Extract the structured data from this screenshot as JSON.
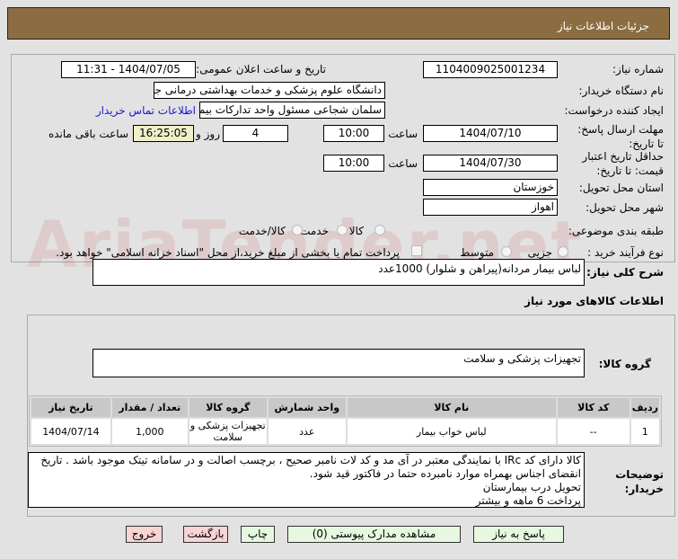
{
  "header": {
    "title": "جزئیات اطلاعات نیاز"
  },
  "form": {
    "need_number_label": "شماره نیاز:",
    "need_number": "1104009025001234",
    "announce_label": "تاریخ و ساعت اعلان عمومی:",
    "announce_value": "1404/07/05 - 11:31",
    "buyer_org_label": "نام دستگاه خریدار:",
    "buyer_org": "دانشگاه علوم پزشکی و خدمات بهداشتی درمانی جندی شاپور اهواز",
    "creator_label": "ایجاد کننده درخواست:",
    "creator": "سلمان شجاعی مسئول واحد تدارکات بیمارستان امام خمینی (ره) دانشگاه علوم",
    "contact_link": "اطلاعات تماس خریدار",
    "deadline_label": "مهلت ارسال پاسخ: تا تاریخ:",
    "deadline_date": "1404/07/10",
    "time_label": "ساعت",
    "deadline_time": "10:00",
    "days": "4",
    "days_label": "روز و",
    "remaining": "16:25:05",
    "remaining_label": "ساعت باقی مانده",
    "validity_label": "حداقل تاریخ اعتبار قیمت: تا تاریخ:",
    "validity_date": "1404/07/30",
    "validity_time": "10:00",
    "province_label": "استان محل تحویل:",
    "province": "خوزستان",
    "city_label": "شهر محل تحویل:",
    "city": "اهواز",
    "category_label": "طبقه بندی موضوعی:",
    "category_options": [
      "کالا",
      "خدمت",
      "کالا/خدمت"
    ],
    "process_label": "نوع فرآیند خرید :",
    "process_options": [
      "جزیی",
      "متوسط"
    ],
    "payment_note": "پرداخت تمام یا بخشی از مبلغ خرید،از محل \"اسناد خزانه اسلامی\" خواهد بود."
  },
  "summary": {
    "label": "شرح کلی نیاز:",
    "value": "لباس بیمار مردانه(پیراهن و شلوار)  1000عدد"
  },
  "goods": {
    "title": "اطلاعات کالاهای مورد نیاز",
    "group_label": "گروه کالا:",
    "group_value": "تجهیزات پزشکی و سلامت",
    "columns": [
      "ردیف",
      "کد کالا",
      "نام کالا",
      "واحد شمارش",
      "گروه کالا",
      "تعداد / مقدار",
      "تاریخ نیاز"
    ],
    "rows": [
      [
        "1",
        "--",
        "لباس خواب بیمار",
        "عدد",
        "تجهیزات پزشکی و سلامت",
        "1,000",
        "1404/07/14"
      ]
    ]
  },
  "notes": {
    "label": "توضیحات خریدار:",
    "lines": [
      "کالا دارای کد IRc با نمایندگی معتبر در آی مد و کد لات نامبر صحیح ، برچسب اصالت و در سامانه تیتک موجود باشد . تاریخ انقضای اجناس بهمراه موارد نامبرده حتما در فاکتور قید شود.",
      "تحویل درب بیمارستان",
      "پرداخت 6 ماهه و بیشتر"
    ]
  },
  "buttons": {
    "reply": "پاسخ به نیاز",
    "attachments": "مشاهده مدارک پیوستی (0)",
    "print": "چاپ",
    "back": "بازگشت",
    "exit": "خروج"
  },
  "watermark": "AriaTender.net"
}
